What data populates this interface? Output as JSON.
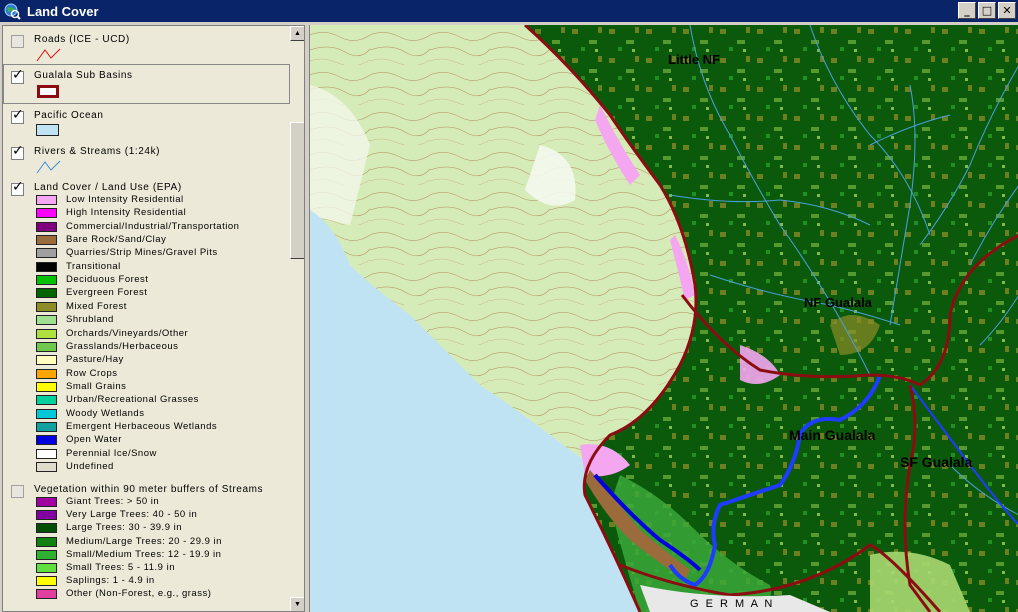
{
  "window": {
    "title": "Land Cover",
    "minimize": "_",
    "maximize": "□",
    "close": "✕"
  },
  "toc": {
    "layers": [
      {
        "name": "Roads (ICE - UCD)",
        "checked": false
      },
      {
        "name": "Gualala Sub Basins",
        "checked": true
      },
      {
        "name": "Pacific Ocean",
        "checked": true
      },
      {
        "name": "Rivers & Streams (1:24k)",
        "checked": true
      },
      {
        "name": "Land Cover / Land Use (EPA)",
        "checked": true
      },
      {
        "name": "Vegetation within 90 meter buffers of Streams",
        "checked": false
      }
    ],
    "landcover_legend": [
      {
        "label": "Low Intensity Residential",
        "color": "#f4a6f0"
      },
      {
        "label": "High Intensity Residential",
        "color": "#ff00ff"
      },
      {
        "label": "Commercial/Industrial/Transportation",
        "color": "#800080"
      },
      {
        "label": "Bare Rock/Sand/Clay",
        "color": "#9c6b3c"
      },
      {
        "label": "Quarries/Strip Mines/Gravel Pits",
        "color": "#a0a0a0"
      },
      {
        "label": "Transitional",
        "color": "#000000"
      },
      {
        "label": "Deciduous Forest",
        "color": "#00c000"
      },
      {
        "label": "Evergreen Forest",
        "color": "#006400"
      },
      {
        "label": "Mixed Forest",
        "color": "#8c8c28"
      },
      {
        "label": "Shrubland",
        "color": "#a0e090"
      },
      {
        "label": "Orchards/Vineyards/Other",
        "color": "#b0e040"
      },
      {
        "label": "Grasslands/Herbaceous",
        "color": "#70c850"
      },
      {
        "label": "Pasture/Hay",
        "color": "#ffffc0"
      },
      {
        "label": "Row Crops",
        "color": "#ffa500"
      },
      {
        "label": "Small Grains",
        "color": "#ffff00"
      },
      {
        "label": "Urban/Recreational Grasses",
        "color": "#00d0a0"
      },
      {
        "label": "Woody Wetlands",
        "color": "#00c8d8"
      },
      {
        "label": "Emergent Herbaceous Wetlands",
        "color": "#10a0a0"
      },
      {
        "label": "Open Water",
        "color": "#0000e0"
      },
      {
        "label": "Perennial Ice/Snow",
        "color": "#ffffff"
      },
      {
        "label": "Undefined",
        "color": "#e0dccc"
      }
    ],
    "vegetation_legend": [
      {
        "label": "Giant Trees: > 50 in",
        "color": "#a000a0"
      },
      {
        "label": "Very Large Trees: 40 - 50 in",
        "color": "#8000a0"
      },
      {
        "label": "Large Trees: 30 - 39.9 in",
        "color": "#005000"
      },
      {
        "label": "Medium/Large Trees: 20 - 29.9 in",
        "color": "#108010"
      },
      {
        "label": "Small/Medium Trees: 12 - 19.9 in",
        "color": "#30b030"
      },
      {
        "label": "Small Trees: 5 - 11.9 in",
        "color": "#60e040"
      },
      {
        "label": "Saplings: 1 - 4.9 in",
        "color": "#ffff00"
      },
      {
        "label": "Other (Non-Forest, e.g., grass)",
        "color": "#e040a0"
      }
    ]
  },
  "map": {
    "labels": [
      "Little NF",
      "NF Gualala",
      "Main Gualala",
      "SF Gualala",
      "G E R M A N"
    ],
    "colors": {
      "ocean": "#bfe3f2",
      "topo": "#d6ecb8",
      "forest": "#0b5a0b",
      "basin_line": "#8b0d12",
      "river": "#1e3cff",
      "stream": "#4aa0e0"
    }
  }
}
